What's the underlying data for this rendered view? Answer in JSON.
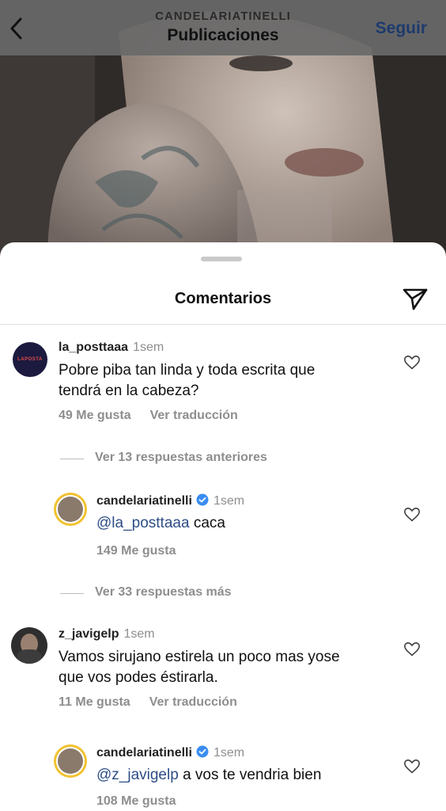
{
  "header": {
    "username": "CANDELARIATINELLI",
    "title": "Publicaciones",
    "follow_label": "Seguir"
  },
  "sheet": {
    "title": "Comentarios"
  },
  "comments": [
    {
      "username": "la_posttaaa",
      "time": "1sem",
      "text": "Pobre piba tan linda y toda escrita que tendrá en la cabeza?",
      "text_line1": "Pobre piba tan linda y toda escrita que",
      "text_line2": "tendrá en la cabeza?",
      "likes": "49 Me gusta",
      "translate": "Ver traducción",
      "avatar_text": "LAPOSTA"
    },
    {
      "username": "z_javigelp",
      "time": "1sem",
      "text": "Vamos sirujano estirela un poco mas yose que vos podes éstirarla.",
      "text_line1": "Vamos sirujano estirela un poco mas yose",
      "text_line2": "que vos podes éstirarla.",
      "likes": "11 Me gusta",
      "translate": "Ver traducción"
    }
  ],
  "replies": [
    {
      "username": "candelariatinelli",
      "time": "1sem",
      "mention": "@la_posttaaa",
      "text": " caca",
      "likes": "149 Me gusta"
    },
    {
      "username": "candelariatinelli",
      "time": "1sem",
      "mention": "@z_javigelp",
      "text": " a vos te vendria bien",
      "likes": "108 Me gusta"
    }
  ],
  "thread_links": [
    "Ver 13 respuestas anteriores",
    "Ver 33 respuestas más"
  ],
  "colors": {
    "accent": "#2d4d86",
    "verified": "#3a8df0",
    "muted": "#8e8e8e"
  },
  "icons": [
    "back-arrow-icon",
    "send-icon",
    "heart-icon",
    "verified-badge-icon"
  ]
}
